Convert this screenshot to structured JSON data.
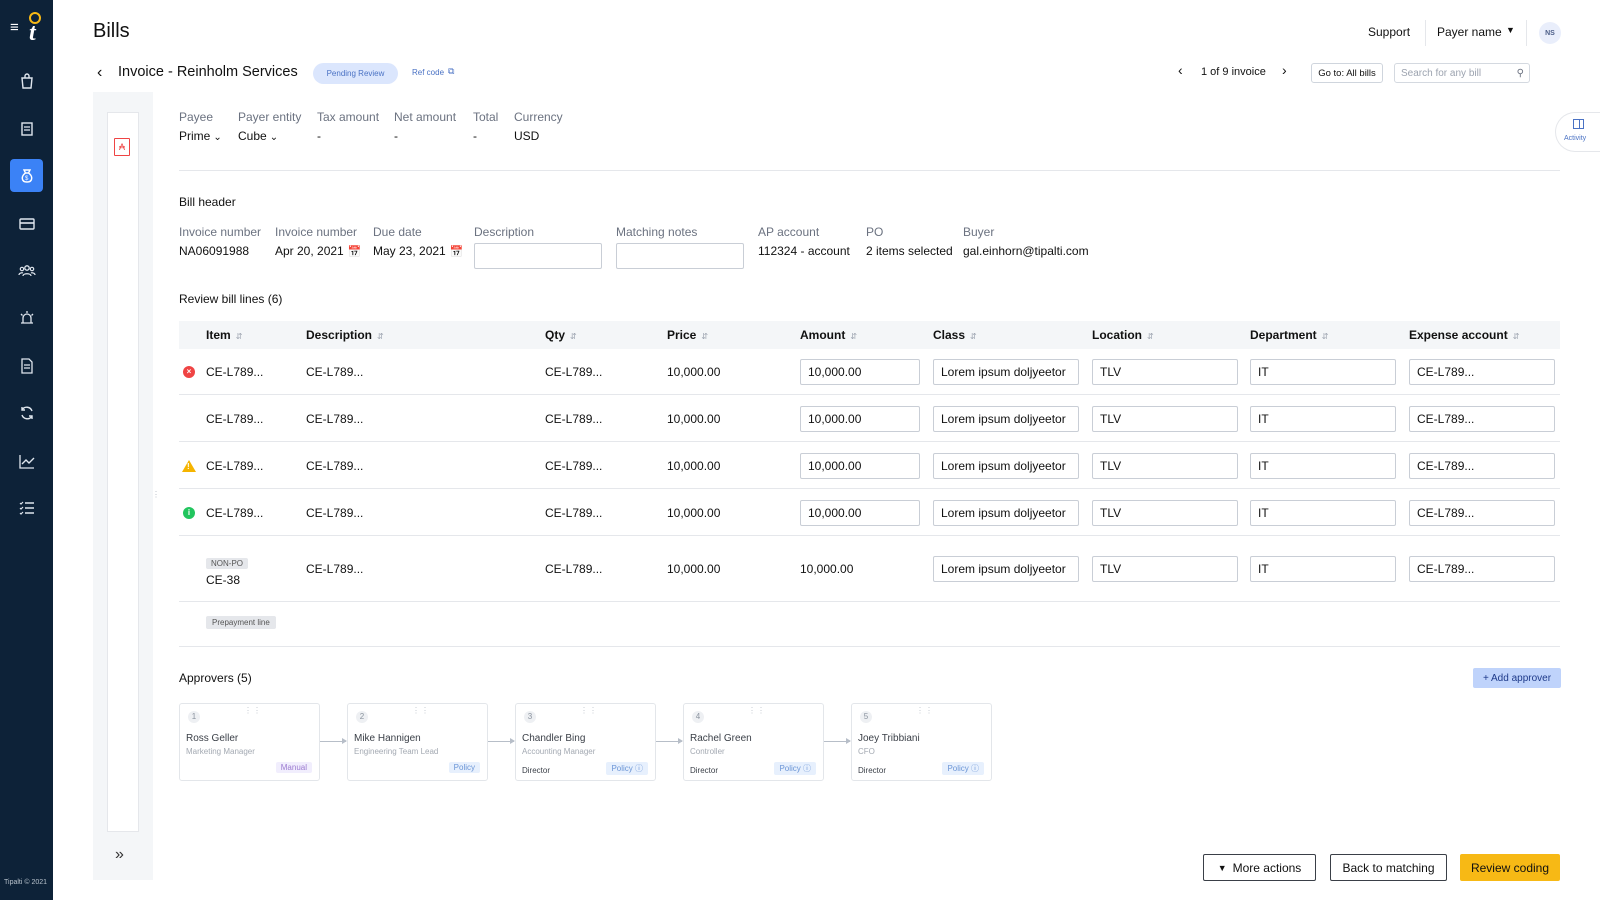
{
  "app": {
    "title": "Bills",
    "copyright": "Tipalti © 2021",
    "logo_letter": "t"
  },
  "nav": {
    "items": [
      {
        "icon": "shopping-bag-icon"
      },
      {
        "icon": "receipt-icon"
      },
      {
        "icon": "money-bag-icon",
        "active": true
      },
      {
        "icon": "credit-card-icon"
      },
      {
        "icon": "users-icon"
      },
      {
        "icon": "alarm-icon"
      },
      {
        "icon": "document-icon"
      },
      {
        "icon": "refresh-icon"
      },
      {
        "icon": "chart-icon"
      },
      {
        "icon": "checklist-icon"
      }
    ]
  },
  "topbar": {
    "support": "Support",
    "payer": "Payer name",
    "avatar": "NS"
  },
  "invoice": {
    "title": "Invoice - Reinholm Services",
    "status": "Pending Review",
    "ref_code": "Ref code",
    "pager": "1 of 9 invoice",
    "goto": "Go to: All bills",
    "search_placeholder": "Search for any bill"
  },
  "activity": {
    "label": "Activity"
  },
  "summary": [
    {
      "label": "Payee",
      "value": "Prime",
      "dropdown": true
    },
    {
      "label": "Payer entity",
      "value": "Cube",
      "dropdown": true
    },
    {
      "label": "Tax amount",
      "value": "-"
    },
    {
      "label": "Net amount",
      "value": "-"
    },
    {
      "label": "Total",
      "value": "-"
    },
    {
      "label": "Currency",
      "value": "USD"
    }
  ],
  "bill_header": {
    "title": "Bill header",
    "invoice_number": {
      "label": "Invoice number",
      "value": "NA06091988"
    },
    "invoice_date": {
      "label": "Invoice number",
      "value": "Apr 20, 2021"
    },
    "due_date": {
      "label": "Due date",
      "value": "May 23, 2021"
    },
    "description": {
      "label": "Description",
      "value": ""
    },
    "matching_notes": {
      "label": "Matching notes",
      "value": ""
    },
    "ap_account": {
      "label": "AP account",
      "value": "112324 -  account"
    },
    "po": {
      "label": "PO",
      "value": "2 items selected"
    },
    "buyer": {
      "label": "Buyer",
      "value": "gal.einhorn@tipalti.com"
    }
  },
  "lines": {
    "title": "Review bill lines (6)",
    "columns": [
      "Item",
      "Description",
      "Qty",
      "Price",
      "Amount",
      "Class",
      "Location",
      "Department",
      "Expense account"
    ],
    "rows": [
      {
        "status": "error",
        "item": "CE-L789...",
        "description": "CE-L789...",
        "qty": "CE-L789...",
        "price": "10,000.00",
        "amount": "10,000.00",
        "class": "Lorem ipsum doljyeetor",
        "location": "TLV",
        "department": "IT",
        "expense": "CE-L789..."
      },
      {
        "status": "",
        "item": "CE-L789...",
        "description": "CE-L789...",
        "qty": "CE-L789...",
        "price": "10,000.00",
        "amount": "10,000.00",
        "class": "Lorem ipsum doljyeetor",
        "location": "TLV",
        "department": "IT",
        "expense": "CE-L789..."
      },
      {
        "status": "warning",
        "item": "CE-L789...",
        "description": "CE-L789...",
        "qty": "CE-L789...",
        "price": "10,000.00",
        "amount": "10,000.00",
        "class": "Lorem ipsum doljyeetor",
        "location": "TLV",
        "department": "IT",
        "expense": "CE-L789..."
      },
      {
        "status": "ok",
        "item": "CE-L789...",
        "description": "CE-L789...",
        "qty": "CE-L789...",
        "price": "10,000.00",
        "amount": "10,000.00",
        "class": "Lorem ipsum doljyeetor",
        "location": "TLV",
        "department": "IT",
        "expense": "CE-L789..."
      },
      {
        "status": "",
        "badge": "NON-PO",
        "item": "CE-38",
        "description": "CE-L789...",
        "qty": "CE-L789...",
        "price": "10,000.00",
        "amount": "10,000.00",
        "class": "Lorem ipsum doljyeetor",
        "location": "TLV",
        "department": "IT",
        "expense": "CE-L789..."
      }
    ],
    "prepayment": "Prepayment line"
  },
  "approvers": {
    "title": "Approvers (5)",
    "add_label": "+ Add approver",
    "list": [
      {
        "num": "1",
        "name": "Ross Geller",
        "role": "Marketing Manager",
        "level": "",
        "badge": "Manual"
      },
      {
        "num": "2",
        "name": "Mike Hannigen",
        "role": "Engineering Team Lead",
        "level": "",
        "badge": "Policy"
      },
      {
        "num": "3",
        "name": "Chandler Bing",
        "role": "Accounting Manager",
        "level": "Director",
        "badge": "Policy ⓘ"
      },
      {
        "num": "4",
        "name": "Rachel Green",
        "role": "Controller",
        "level": "Director",
        "badge": "Policy ⓘ"
      },
      {
        "num": "5",
        "name": "Joey Tribbiani",
        "role": "CFO",
        "level": "Director",
        "badge": "Policy ⓘ"
      }
    ]
  },
  "footer": {
    "more_actions": "More actions",
    "back": "Back to matching",
    "review": "Review coding"
  },
  "colors": {
    "nav_bg": "#0d2238",
    "accent": "#3b82f6",
    "primary_button": "#f7b915",
    "error": "#ef4444",
    "warning": "#f5b400",
    "success": "#22c55e"
  }
}
